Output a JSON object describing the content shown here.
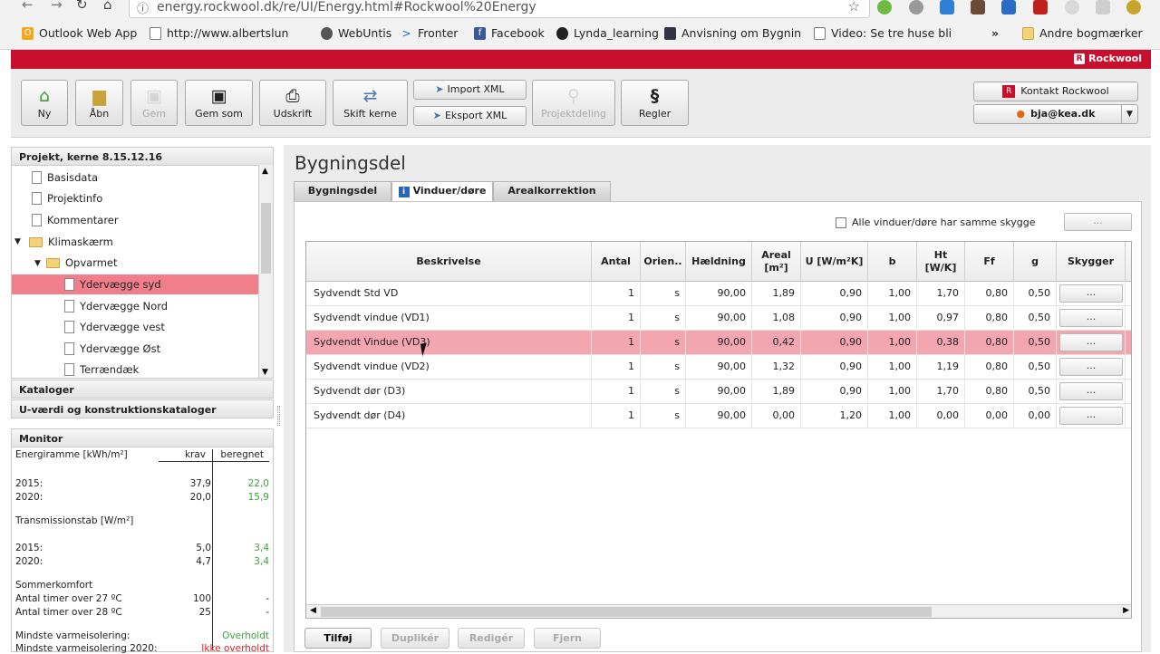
{
  "browser": {
    "url": "energy.rockwool.dk/re/UI/Energy.html#Rockwool%20Energy",
    "bookmarks": [
      "Outlook Web App",
      "http://www.albertslun",
      "WebUntis",
      "Fronter",
      "Facebook",
      "Lynda_learning",
      "Anvisning om Bygnin",
      "Video: Se tre huse bli"
    ],
    "other_bookmarks": "Andre bogmærker",
    "overflow": "»"
  },
  "brand": "Rockwool",
  "toolbar": {
    "buttons": [
      "Ny",
      "Åbn",
      "Gem",
      "Gem som",
      "Udskrift",
      "Skift kerne",
      "Projektdeling",
      "Regler"
    ],
    "import_xml": "Import XML",
    "export_xml": "Eksport XML",
    "contact": "Kontakt Rockwool",
    "user": "bja@kea.dk"
  },
  "sidebar": {
    "project_header": "Projekt, kerne 8.15.12.16",
    "tree": [
      "Basisdata",
      "Projektinfo",
      "Kommentarer",
      "Klimaskærm",
      "Opvarmet",
      "Ydervægge syd",
      "Ydervægge Nord",
      "Ydervægge vest",
      "Ydervægge Øst",
      "Terrændæk"
    ],
    "catalogs": "Kataloger",
    "u_catalogs": "U-værdi og konstruktionskataloger",
    "monitor_header": "Monitor"
  },
  "monitor": {
    "energy_label": "Energiramme [kWh/m²]",
    "krav": "krav",
    "beregnet": "beregnet",
    "energy_rows": [
      {
        "year": "2015:",
        "krav": "37,9",
        "beregnet": "22,0"
      },
      {
        "year": "2020:",
        "krav": "20,0",
        "beregnet": "15,9"
      }
    ],
    "trans_label": "Transmissionstab [W/m²]",
    "trans_rows": [
      {
        "year": "2015:",
        "krav": "5,0",
        "beregnet": "3,4"
      },
      {
        "year": "2020:",
        "krav": "4,7",
        "beregnet": "3,4"
      }
    ],
    "summer_label": "Sommerkomfort",
    "summer_rows": [
      {
        "label": "Antal timer over 27 ºC",
        "krav": "100",
        "beregnet": "-"
      },
      {
        "label": "Antal timer over 28 ºC",
        "krav": "25",
        "beregnet": "-"
      }
    ],
    "insulation": [
      {
        "label": "Mindste varmeisolering:",
        "status": "Overholdt"
      },
      {
        "label": "Mindste varmeisolering 2020:",
        "status": "Ikke overholdt"
      }
    ]
  },
  "main": {
    "title": "Bygningsdel",
    "tabs": [
      "Bygningsdel",
      "Vinduer/døre",
      "Arealkorrektion"
    ],
    "same_shadow_label": "Alle vinduer/døre har samme skygge",
    "dots": "...",
    "columns": [
      "Beskrivelse",
      "Antal",
      "Orien..",
      "Hældning",
      "Areal [m²]",
      "U [W/m²K]",
      "b",
      "Ht [W/K]",
      "Ff",
      "g",
      "Skygger"
    ],
    "rows": [
      [
        "Sydvendt Std VD",
        "1",
        "s",
        "90,00",
        "1,89",
        "0,90",
        "1,00",
        "1,70",
        "0,80",
        "0,50",
        "..."
      ],
      [
        "Sydvendt vindue (VD1)",
        "1",
        "s",
        "90,00",
        "1,08",
        "0,90",
        "1,00",
        "0,97",
        "0,80",
        "0,50",
        "..."
      ],
      [
        "Sydvendt Vindue (VD3)",
        "1",
        "s",
        "90,00",
        "0,42",
        "0,90",
        "1,00",
        "0,38",
        "0,80",
        "0,50",
        "..."
      ],
      [
        "Sydvendt vindue (VD2)",
        "1",
        "s",
        "90,00",
        "1,32",
        "0,90",
        "1,00",
        "1,19",
        "0,80",
        "0,50",
        "..."
      ],
      [
        "Sydvendt dør (D3)",
        "1",
        "s",
        "90,00",
        "1,89",
        "0,90",
        "1,00",
        "1,70",
        "0,80",
        "0,50",
        "..."
      ],
      [
        "Sydvendt dør (D4)",
        "1",
        "s",
        "90,00",
        "0,00",
        "1,20",
        "1,00",
        "0,00",
        "0,00",
        "0,00",
        "..."
      ]
    ],
    "actions": [
      "Tilføj",
      "Duplikér",
      "Redigér",
      "Fjern"
    ]
  }
}
